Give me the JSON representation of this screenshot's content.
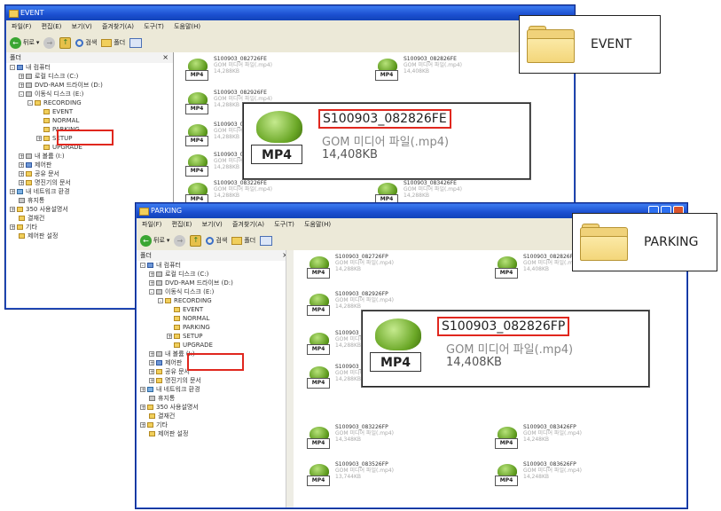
{
  "event_window": {
    "title": "EVENT",
    "menu": [
      "파일(F)",
      "편집(E)",
      "보기(V)",
      "즐겨찾기(A)",
      "도구(T)",
      "도움말(H)"
    ],
    "toolbar": {
      "back": "뒤로",
      "search": "검색",
      "folders": "폴더"
    },
    "pane_title": "폴더",
    "tree": [
      "내 컴퓨터",
      "로컬 디스크 (C:)",
      "DVD-RAM 드라이브 (D:)",
      "이동식 디스크 (E:)",
      "RECORDING",
      "EVENT",
      "NORMAL",
      "PARKING",
      "SETUP",
      "UPGRADE",
      "내 볼륨 (I:)",
      "제어판",
      "공유 문서",
      "명진기의 문서",
      "내 네트워크 환경",
      "휴지통",
      "350 사용설명서",
      "결재건",
      "기타",
      "제어판 설정"
    ],
    "files": [
      {
        "name": "S100903_082726FE",
        "type": "GOM 미디어 파일(.mp4)",
        "size": "14,288KB"
      },
      {
        "name": "S100903_082826FE",
        "type": "GOM 미디어 파일(.mp4)",
        "size": "14,408KB"
      },
      {
        "name": "S100903_082926FE",
        "type": "GOM 미디어 파일(.mp4)",
        "size": "14,288KB"
      },
      {
        "name": "S100903_083026FE",
        "type": "GOM 미디어 파일(.mp4)",
        "size": "14,288KB"
      },
      {
        "name": "S100903_083126FE",
        "type": "GOM 미디어 파일(.mp4)",
        "size": "14,288KB"
      },
      {
        "name": "S100903_083226FE",
        "type": "GOM 미디어 파일(.mp4)",
        "size": "14,288KB"
      },
      {
        "name": "S100903_083426FE",
        "type": "GOM 미디어 파일(.mp4)",
        "size": "14,288KB"
      }
    ],
    "zoom": {
      "name": "S100903_082826FE",
      "type": "GOM 미디어 파일(.mp4)",
      "size": "14,408KB",
      "icon_label": "MP4"
    },
    "callout": "EVENT"
  },
  "parking_window": {
    "title": "PARKING",
    "menu": [
      "파일(F)",
      "편집(E)",
      "보기(V)",
      "즐겨찾기(A)",
      "도구(T)",
      "도움말(H)"
    ],
    "toolbar": {
      "back": "뒤로",
      "search": "검색",
      "folders": "폴더"
    },
    "pane_title": "폴더",
    "tree": [
      "내 컴퓨터",
      "로컬 디스크 (C:)",
      "DVD-RAM 드라이브 (D:)",
      "이동식 디스크 (E:)",
      "RECORDING",
      "EVENT",
      "NORMAL",
      "PARKING",
      "SETUP",
      "UPGRADE",
      "내 볼륨 (I:)",
      "제어판",
      "공유 문서",
      "명진기의 문서",
      "내 네트워크 환경",
      "휴지통",
      "350 사용설명서",
      "결재건",
      "기타",
      "제어판 설정"
    ],
    "files": [
      {
        "name": "S100903_082726FP",
        "type": "GOM 미디어 파일(.mp4)",
        "size": "14,288KB"
      },
      {
        "name": "S100903_082826FP",
        "type": "GOM 미디어 파일(.mp4)",
        "size": "14,408KB"
      },
      {
        "name": "S100903_082926FP",
        "type": "GOM 미디어 파일(.mp4)",
        "size": "14,288KB"
      },
      {
        "name": "S100903_083026FP",
        "type": "GOM 미디어 파일(.mp4)",
        "size": "14,288KB"
      },
      {
        "name": "S100903_083126FP",
        "type": "GOM 미디어 파일(.mp4)",
        "size": "14,288KB"
      },
      {
        "name": "S100903_083226FP",
        "type": "GOM 미디어 파일(.mp4)",
        "size": "14,348KB"
      },
      {
        "name": "S100903_083426FP",
        "type": "GOM 미디어 파일(.mp4)",
        "size": "14,248KB"
      },
      {
        "name": "S100903_083526FP",
        "type": "GOM 미디어 파일(.mp4)",
        "size": "13,744KB"
      },
      {
        "name": "S100903_083626FP",
        "type": "GOM 미디어 파일(.mp4)",
        "size": "14,248KB"
      }
    ],
    "zoom": {
      "name": "S100903_082826FP",
      "type": "GOM 미디어 파일(.mp4)",
      "size": "14,408KB",
      "icon_label": "MP4"
    },
    "callout": "PARKING"
  },
  "colors": {
    "title_bar": "#1b4fd0",
    "highlight": "#e0271e",
    "folder": "#f1cf5b"
  }
}
